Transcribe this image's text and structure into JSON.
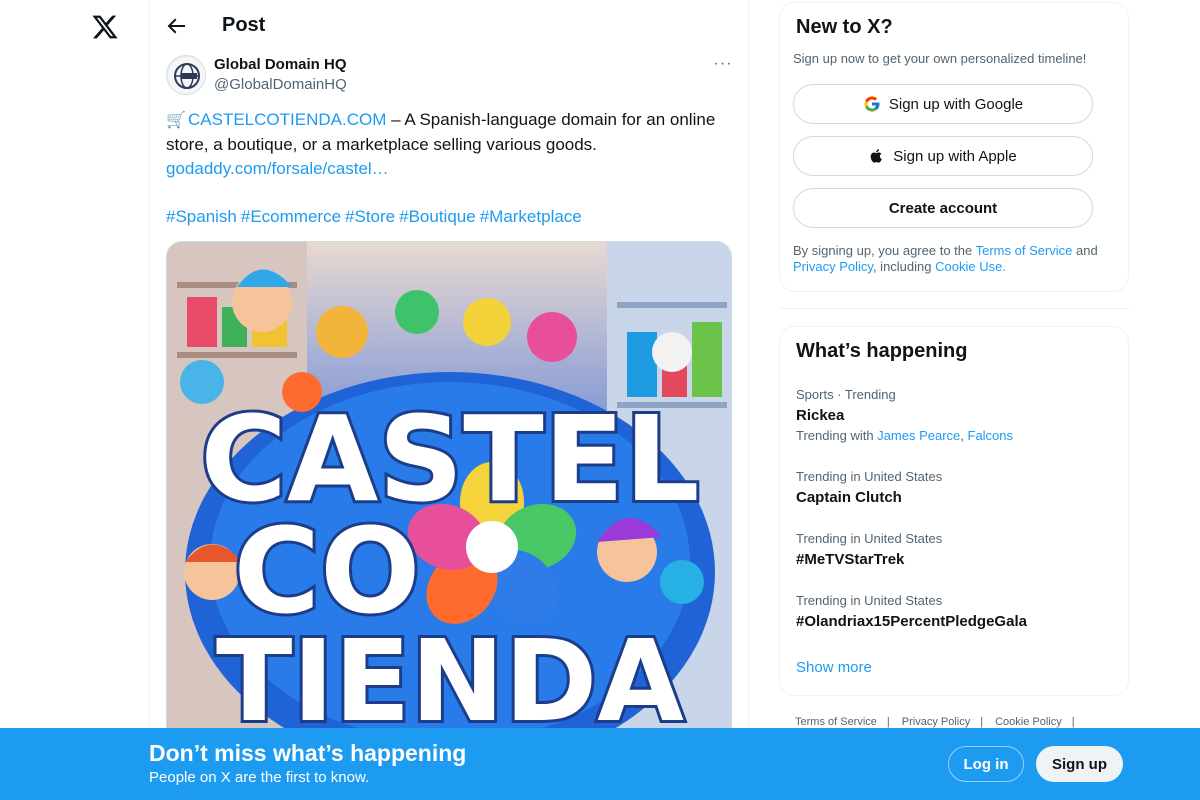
{
  "nav": {
    "logo_icon": "x-logo-icon"
  },
  "header": {
    "title": "Post",
    "back_icon": "arrow-left-icon"
  },
  "post": {
    "author_name": "Global Domain HQ",
    "author_handle": "@GlobalDomainHQ",
    "more_icon": "ellipsis-icon",
    "more_label": "···",
    "cart_emoji": "🛒",
    "domain_link": "CASTELCOTIENDA.COM",
    "body_text": " – A Spanish-language domain for an online store, a boutique, or a marketplace selling various goods.",
    "url": "godaddy.com/forsale/castel…",
    "hashtags": [
      "#Spanish",
      "#Ecommerce",
      "#Store",
      "#Boutique",
      "#Marketplace"
    ],
    "image_text": [
      "CASTEL",
      "CO",
      "TIENDA"
    ]
  },
  "signup": {
    "title": "New to X?",
    "subtitle": "Sign up now to get your own personalized timeline!",
    "google_label": "Sign up with Google",
    "apple_label": "Sign up with Apple",
    "create_label": "Create account",
    "terms_prefix": "By signing up, you agree to the ",
    "terms_link": "Terms of Service",
    "terms_and": " and",
    "privacy_link": "Privacy Policy",
    "terms_including": ", including ",
    "cookie_link": "Cookie Use."
  },
  "trending": {
    "title": "What’s happening",
    "items": [
      {
        "meta": "Sports · Trending",
        "name": "Rickea",
        "with_prefix": "Trending with ",
        "with_a": "James Pearce",
        "with_sep": ", ",
        "with_b": "Falcons"
      },
      {
        "meta": "Trending in United States",
        "name": "Captain Clutch"
      },
      {
        "meta": "Trending in United States",
        "name": "#MeTVStarTrek"
      },
      {
        "meta": "Trending in United States",
        "name": "#Olandriax15PercentPledgeGala"
      }
    ],
    "show_more": "Show more"
  },
  "footer": {
    "links": [
      "Terms of Service",
      "Privacy Policy",
      "Cookie Policy"
    ],
    "separator": "|"
  },
  "bottom_bar": {
    "title": "Don’t miss what’s happening",
    "subtitle": "People on X are the first to know.",
    "login_label": "Log in",
    "signup_label": "Sign up"
  },
  "colors": {
    "accent": "#1d9bf0",
    "text": "#0f1419",
    "muted": "#536471"
  }
}
